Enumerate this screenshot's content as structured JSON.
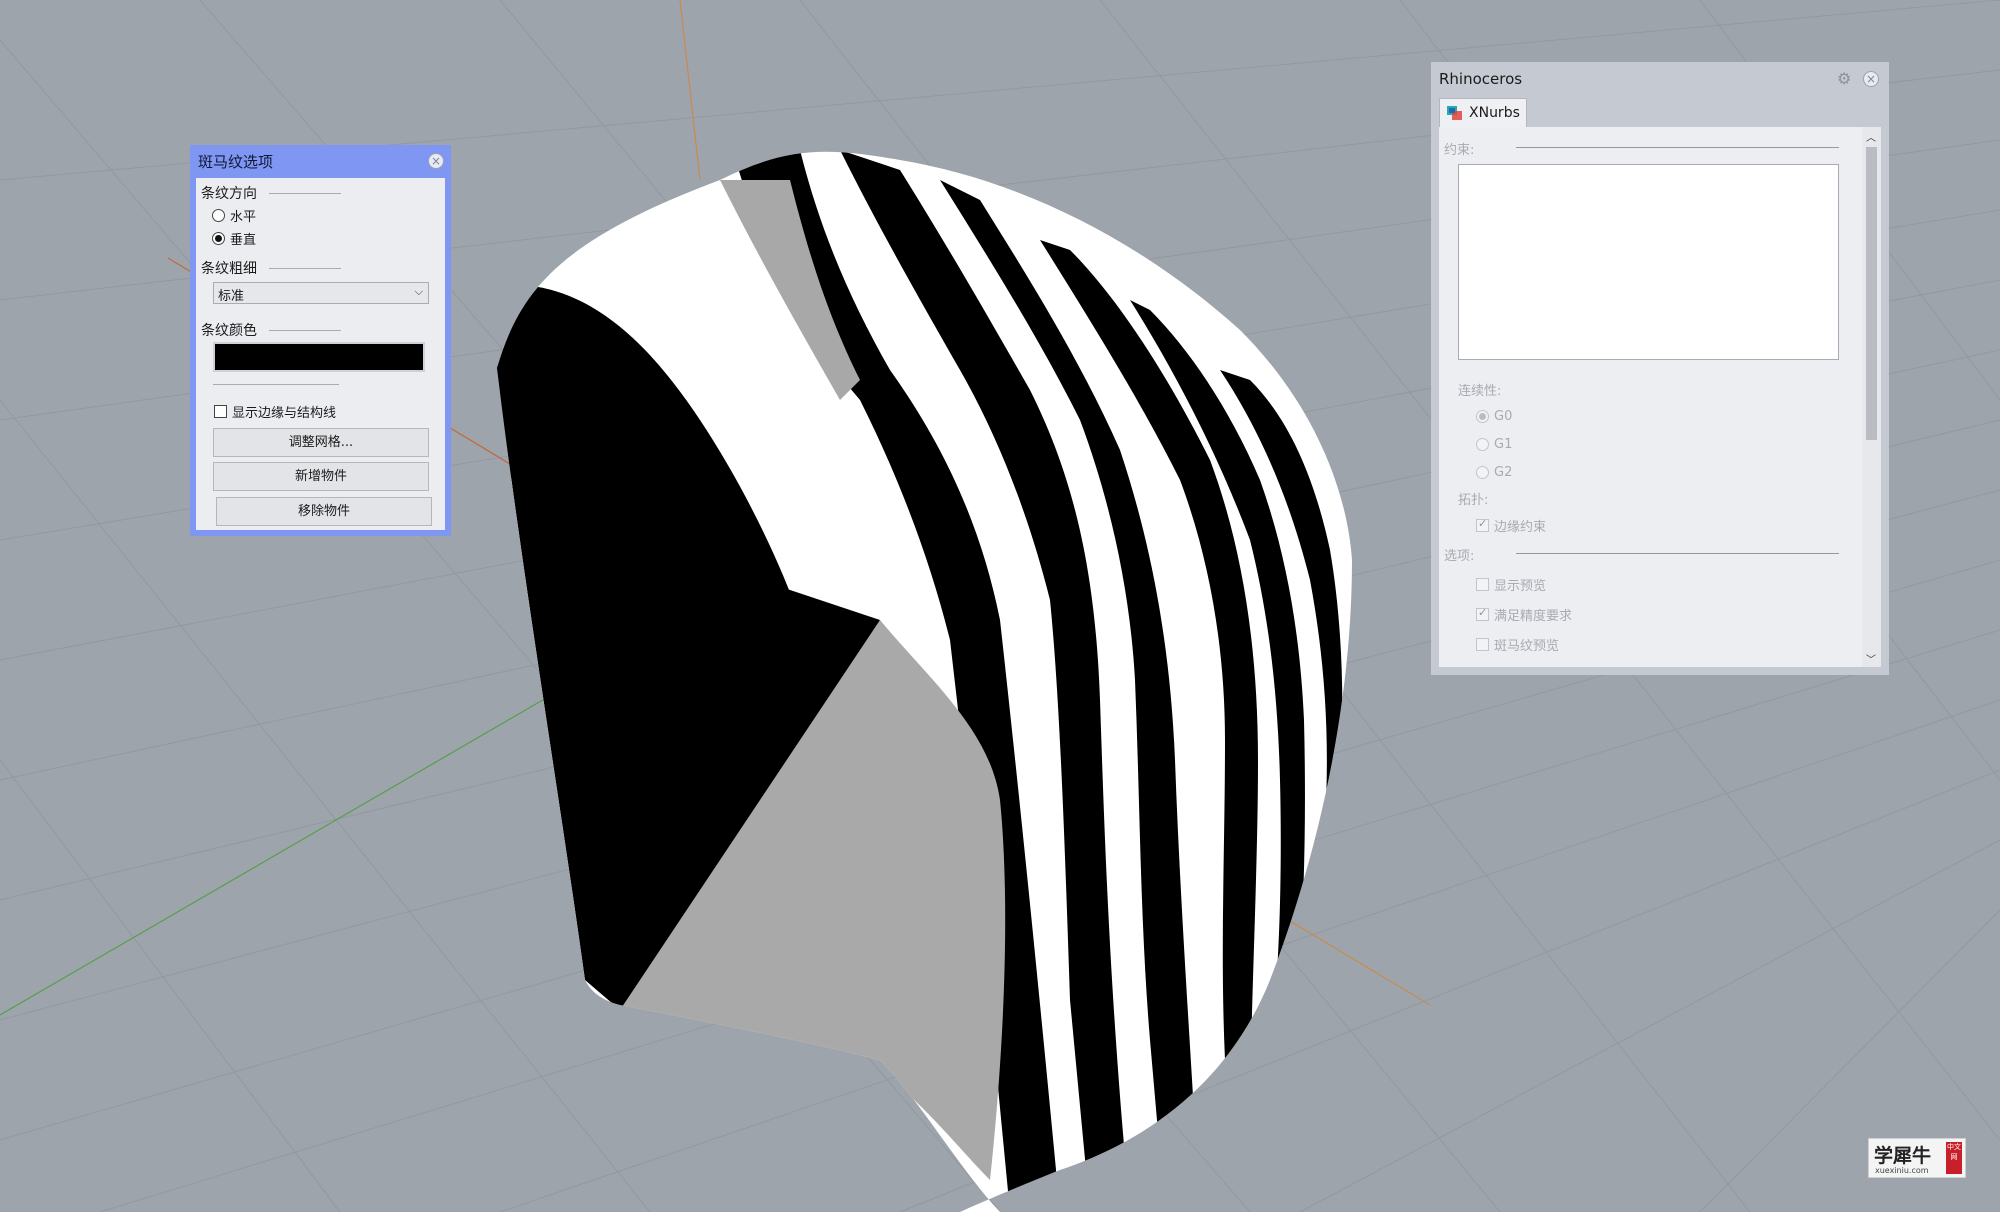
{
  "zebra_dialog": {
    "title": "斑马纹选项",
    "direction_label": "条纹方向",
    "direction_options": [
      "水平",
      "垂直"
    ],
    "direction_selected": "垂直",
    "thickness_label": "条纹粗细",
    "thickness_value": "标准",
    "color_label": "条纹颜色",
    "stripe_color": "#000000",
    "show_edges_label": "显示边缘与结构线",
    "show_edges_checked": false,
    "buttons": {
      "adjust_mesh": "调整网格...",
      "add_object": "新增物件",
      "remove_object": "移除物件"
    }
  },
  "xnurbs_panel": {
    "title": "Rhinoceros",
    "tab_label": "XNurbs",
    "constraints_label": "约束:",
    "continuity_label": "连续性:",
    "continuity_options": [
      "G0",
      "G1",
      "G2"
    ],
    "continuity_selected": "G0",
    "topology_label": "拓扑:",
    "edge_constraint_label": "边缘约束",
    "edge_constraint_checked": true,
    "options_label": "选项:",
    "options": [
      {
        "label": "显示预览",
        "checked": false
      },
      {
        "label": "满足精度要求",
        "checked": true
      },
      {
        "label": "斑马纹预览",
        "checked": false
      }
    ]
  },
  "watermark": {
    "main": "学犀牛",
    "sub": "xuexiniu.com",
    "seal": "中文网"
  },
  "colors": {
    "viewport_bg": "#9ea4ab",
    "grid_line": "#8e949b",
    "x_axis": "#c3683f",
    "y_axis": "#55a04c",
    "z_axis": "#c98a52",
    "dialog_frame": "#7f96f2"
  }
}
